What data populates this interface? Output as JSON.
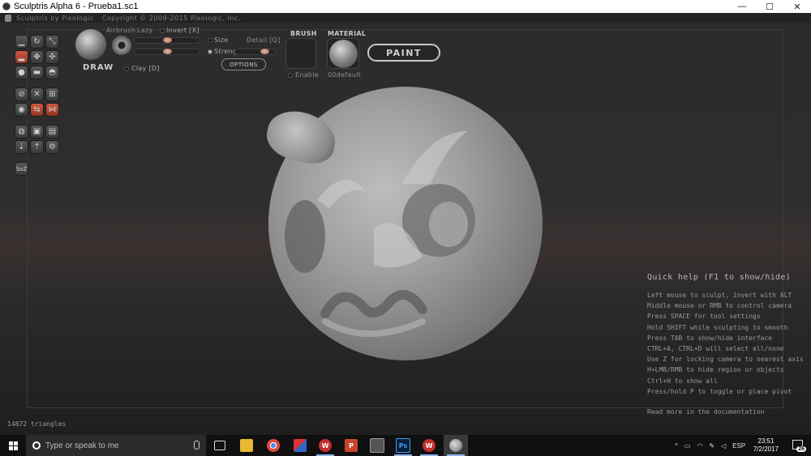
{
  "window": {
    "title": "Sculptris Alpha 6 - Prueba1.sc1",
    "minimize": "—",
    "maximize": "☐",
    "close": "✕"
  },
  "header": {
    "app_name": "Sculptris by Pixologic",
    "copyright": "Copyright © 2009-2015 Pixologic, Inc."
  },
  "tools": {
    "symmetry_label": "SoZ"
  },
  "brush_options": {
    "draw_label": "DRAW",
    "airbrush_label": "Airbrush",
    "lazy_label": "Lazy",
    "invert_label": "Invert [X]",
    "size_label": "Size",
    "strength_label": "Strength",
    "detail_label": "Detail [Q]",
    "clay_label": "Clay [D]",
    "options_button": "OPTIONS"
  },
  "brush_panel": {
    "brush_title": "BRUSH",
    "enable_label": "Enable",
    "material_title": "MATERIAL",
    "material_name": "00default",
    "paint_button": "PAINT"
  },
  "quick_help": {
    "title": "Quick help (F1 to show/hide)",
    "lines": [
      "Left mouse to sculpt, invert with ALT",
      "Middle mouse or RMB to control camera",
      "Press SPACE for tool settings",
      "Hold SHIFT while sculpting to smooth",
      "Press TAB to show/hide interface",
      "CTRL+A, CTRL+D will select all/none",
      "Use Z for locking camera to nearest axis",
      "H+LMB/RMB to hide region or objects",
      "Ctrl+H to show all",
      "Press/hold P to toggle or place pivot"
    ],
    "more": "Read more in the documentation"
  },
  "status": {
    "triangles": "14872 triangles"
  },
  "taskbar": {
    "search_placeholder": "Type or speak to me",
    "language": "ESP",
    "time": "23:51",
    "date": "7/2/2017",
    "notifications": "26"
  },
  "colors": {
    "accent_tool": "#c04a30",
    "paint_border": "#c8c8c8"
  }
}
